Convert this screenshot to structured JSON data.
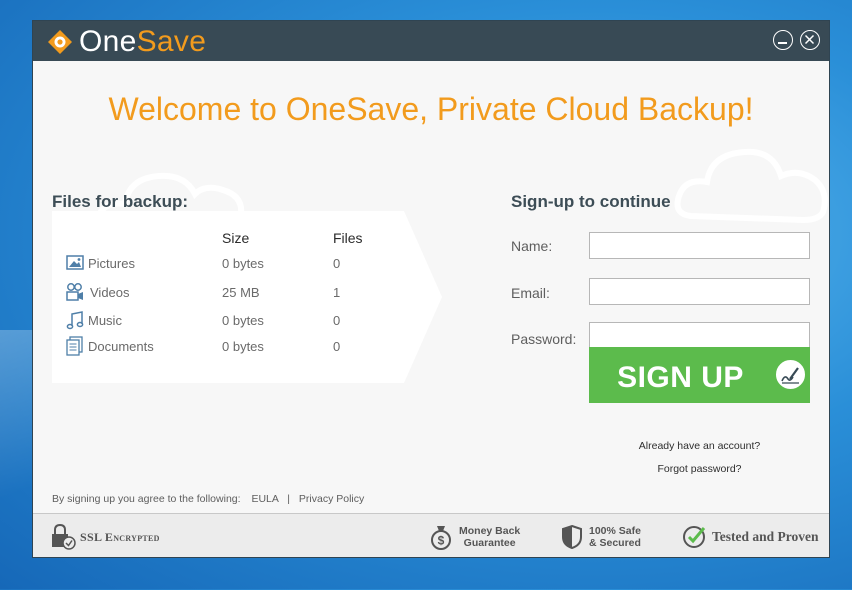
{
  "app": {
    "name_part1": "One",
    "name_part2": "Save",
    "accent_color": "#f29b1d",
    "header_color": "#384a55",
    "button_color": "#5cbb4c"
  },
  "window_controls": {
    "minimize_icon": "minimize-circle-icon",
    "close_icon": "close-circle-icon"
  },
  "welcome_title": "Welcome to OneSave, Private Cloud Backup!",
  "files": {
    "heading": "Files for backup:",
    "columns": {
      "size": "Size",
      "files": "Files"
    },
    "rows": [
      {
        "icon": "picture-icon",
        "name": "Pictures",
        "size": "0 bytes",
        "count": "0"
      },
      {
        "icon": "video-icon",
        "name": "Videos",
        "size": "25 MB",
        "count": "1"
      },
      {
        "icon": "music-icon",
        "name": "Music",
        "size": "0 bytes",
        "count": "0"
      },
      {
        "icon": "documents-icon",
        "name": "Documents",
        "size": "0 bytes",
        "count": "0"
      }
    ]
  },
  "signup": {
    "heading": "Sign-up to continue",
    "name_label": "Name:",
    "name_value": "",
    "email_label": "Email:",
    "email_value": "",
    "password_label": "Password:",
    "password_value": "",
    "button_label": "SIGN UP",
    "button_icon": "signature-pen-icon",
    "already_account": "Already have an account?",
    "forgot_password": "Forgot password?"
  },
  "legal": {
    "text": "By signing up you agree to the following:",
    "eula": "EULA",
    "separator": "|",
    "privacy": "Privacy Policy"
  },
  "footer": {
    "ssl": "SSL Encrypted",
    "money_back_line1": "Money Back",
    "money_back_line2": "Guarantee",
    "safe_line1": "100% Safe",
    "safe_line2": "& Secured",
    "tested": "Tested and Proven"
  }
}
